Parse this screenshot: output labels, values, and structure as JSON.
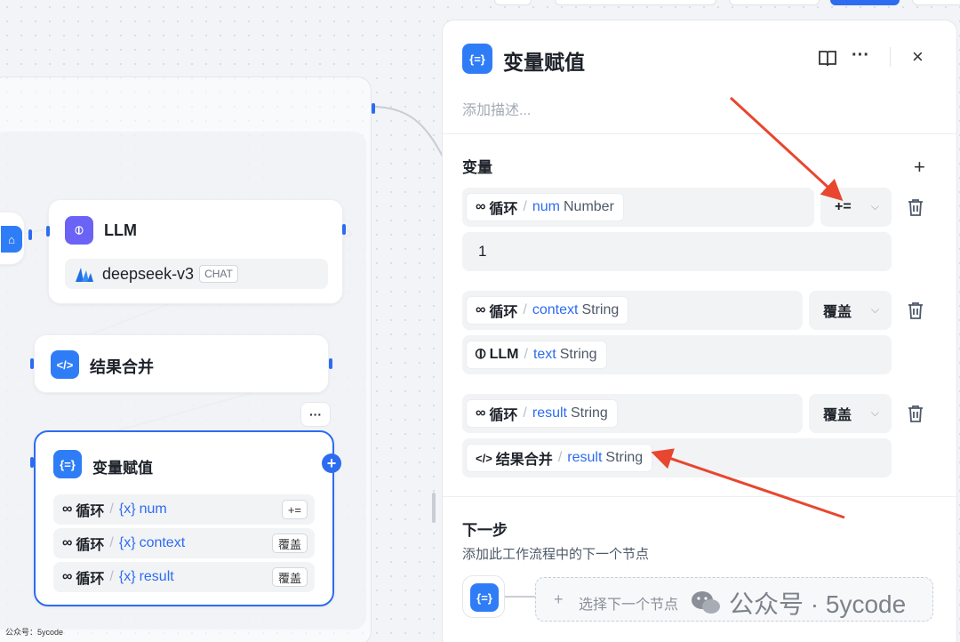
{
  "canvas": {
    "llm_node": {
      "title": "LLM",
      "model": "deepseek-v3",
      "model_badge": "CHAT"
    },
    "merge_node": {
      "title": "结果合并"
    },
    "assign_node": {
      "title": "变量赋值",
      "rows": [
        {
          "scope": "循环",
          "var": "num",
          "op": "+="
        },
        {
          "scope": "循环",
          "var": "context",
          "op": "覆盖"
        },
        {
          "scope": "循环",
          "var": "result",
          "op": "覆盖"
        }
      ]
    },
    "more_label": "···",
    "footer_text": "公众号：5ycode"
  },
  "panel": {
    "title": "变量赋值",
    "description_placeholder": "添加描述...",
    "variables_label": "变量",
    "assignments": [
      {
        "scope": "循环",
        "var": "num",
        "type": "Number",
        "op": "+=",
        "value": "1"
      },
      {
        "scope": "循环",
        "var": "context",
        "type": "String",
        "op": "覆盖",
        "source_scope": "LLM",
        "source_var": "text",
        "source_type": "String"
      },
      {
        "scope": "循环",
        "var": "result",
        "type": "String",
        "op": "覆盖",
        "source_scope": "结果合并",
        "source_var": "result",
        "source_type": "String"
      }
    ],
    "next_step": {
      "title": "下一步",
      "hint": "添加此工作流程中的下一个节点",
      "select_label": "选择下一个节点"
    }
  },
  "watermark": {
    "text": "公众号 · 5ycode"
  },
  "colors": {
    "accent": "#2d6cf0",
    "arrow": "#e8462f"
  }
}
